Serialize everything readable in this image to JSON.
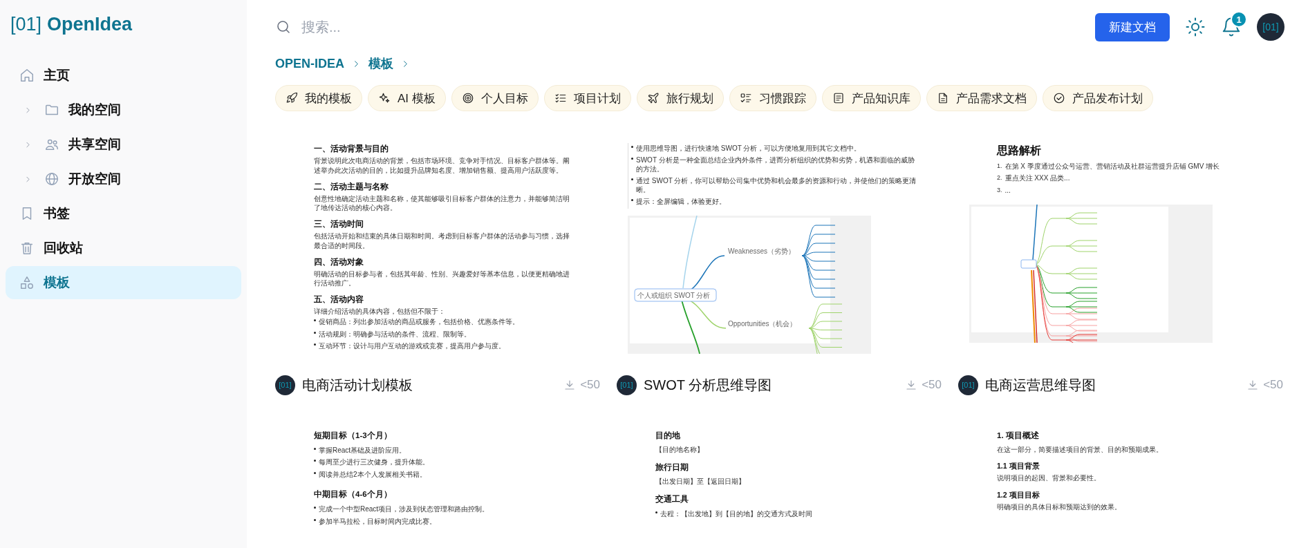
{
  "sidebar": {
    "logo": {
      "mark": "[01]",
      "name": "OpenIdea"
    },
    "items": [
      {
        "label": "主页",
        "kind": "link",
        "selected": false
      },
      {
        "label": "我的空间",
        "kind": "group",
        "expanded": false,
        "selected": false
      },
      {
        "label": "共享空间",
        "kind": "group",
        "expanded": false,
        "selected": false
      },
      {
        "label": "开放空间",
        "kind": "group",
        "expanded": false,
        "selected": false
      },
      {
        "label": "书签",
        "kind": "link",
        "selected": false
      },
      {
        "label": "回收站",
        "kind": "link",
        "selected": false
      },
      {
        "label": "模板",
        "kind": "link",
        "selected": true
      }
    ]
  },
  "header": {
    "search": {
      "placeholder": "搜索..."
    },
    "new_button": "新建文档",
    "notification_count": "1",
    "avatar": "[01]"
  },
  "breadcrumb": [
    "OPEN-IDEA",
    "模板"
  ],
  "categories": [
    "我的模板",
    "AI 模板",
    "个人目标",
    "项目计划",
    "旅行规划",
    "习惯跟踪",
    "产品知识库",
    "产品需求文档",
    "产品发布计划"
  ],
  "cards": [
    {
      "title": "电商活动计划模板",
      "avatar": "[01]",
      "downloads": "<50",
      "preview": {
        "blocks": [
          {
            "kind": "h",
            "text": "一、活动背景与目的"
          },
          {
            "kind": "p",
            "text": "背景说明此次电商活动的背景，包括市场环境、竞争对手情况、目标客户群体等。阐述举办此次活动的目的，比如提升品牌知名度、增加销售额、提高用户活跃度等。"
          },
          {
            "kind": "h",
            "text": "二、活动主题与名称"
          },
          {
            "kind": "p",
            "text": "创意性地确定活动主题和名称，使其能够吸引目标客户群体的注意力，并能够简洁明了地传达活动的核心内容。"
          },
          {
            "kind": "h",
            "text": "三、活动时间"
          },
          {
            "kind": "p",
            "text": "包括活动开始和结束的具体日期和时间。考虑到目标客户群体的活动参与习惯，选择最合适的时间段。"
          },
          {
            "kind": "h",
            "text": "四、活动对象"
          },
          {
            "kind": "p",
            "text": "明确活动的目标参与者，包括其年龄、性别、兴趣爱好等基本信息，以便更精确地进行活动推广。"
          },
          {
            "kind": "h",
            "text": "五、活动内容"
          },
          {
            "kind": "p",
            "text": "详细介绍活动的具体内容，包括但不限于："
          },
          {
            "kind": "li",
            "text": "促销商品：列出参加活动的商品或服务，包括价格、优惠条件等。"
          },
          {
            "kind": "li",
            "text": "活动规则：明确参与活动的条件、流程、限制等。"
          },
          {
            "kind": "li",
            "text": "互动环节：设计与用户互动的游戏或竞赛，提高用户参与度。"
          }
        ]
      }
    },
    {
      "title": "SWOT 分析思维导图",
      "avatar": "[01]",
      "downloads": "<50",
      "preview": {
        "blocks": [
          {
            "kind": "quote",
            "items": [
              "使用思维导图，进行快速地 SWOT 分析，可以方便地复用到其它文档中。",
              "SWOT 分析是一种全面总结企业内外条件，进而分析组织的优势和劣势，机遇和面临的威胁的方法。",
              "通过 SWOT 分析，你可以帮助公司集中优势和机会最多的资源和行动，并使他们的策略更清晰。",
              "提示：全屏编辑，体验更好。"
            ]
          },
          {
            "kind": "swot_mindmap",
            "nodes": [
              "个人或组织 SWOT 分析",
              "Weaknesses（劣势）",
              "Opportunities（机会）"
            ]
          }
        ]
      }
    },
    {
      "title": "电商运营思维导图",
      "avatar": "[01]",
      "downloads": "<50",
      "preview": {
        "blocks": [
          {
            "kind": "title",
            "text": "思路解析"
          },
          {
            "kind": "ol",
            "number": "1.",
            "text": "在第 X 季度通过公众号运营、营销活动及社群运营提升店铺 GMV 增长"
          },
          {
            "kind": "ol",
            "number": "2.",
            "text": "重点关注 XXX 品类..."
          },
          {
            "kind": "ol",
            "number": "3.",
            "text": "..."
          },
          {
            "kind": "tree_mindmap"
          }
        ]
      }
    },
    {
      "preview": {
        "blocks": [
          {
            "kind": "h2",
            "text": "短期目标（1-3个月）"
          },
          {
            "kind": "li",
            "text": "掌握React基础及进阶应用。"
          },
          {
            "kind": "li",
            "text": "每周至少进行三次健身，提升体能。"
          },
          {
            "kind": "li",
            "text": "阅读并总结2本个人发展相关书籍。"
          },
          {
            "kind": "h2",
            "text": "中期目标（4-6个月）"
          },
          {
            "kind": "li",
            "text": "完成一个中型React项目，涉及到状态管理和路由控制。"
          },
          {
            "kind": "li",
            "text": "参加半马拉松，目标时间内完成比赛。"
          }
        ]
      }
    },
    {
      "preview": {
        "blocks": [
          {
            "kind": "h2",
            "text": "目的地"
          },
          {
            "kind": "p",
            "text": "【目的地名称】"
          },
          {
            "kind": "h2",
            "text": "旅行日期"
          },
          {
            "kind": "p",
            "text": "【出发日期】至【返回日期】"
          },
          {
            "kind": "h2",
            "text": "交通工具"
          },
          {
            "kind": "li",
            "text": "去程：【出发地】到【目的地】的交通方式及时间"
          }
        ]
      }
    },
    {
      "preview": {
        "blocks": [
          {
            "kind": "h2",
            "text": "1. 项目概述"
          },
          {
            "kind": "p",
            "text": "在这一部分，简要描述项目的背景、目的和预期成果。"
          },
          {
            "kind": "h3",
            "text": "1.1 项目背景"
          },
          {
            "kind": "p",
            "text": "说明项目的起因、背景和必要性。"
          },
          {
            "kind": "h3",
            "text": "1.2 项目目标"
          },
          {
            "kind": "p",
            "text": "明确项目的具体目标和预期达到的效果。"
          }
        ]
      }
    }
  ]
}
